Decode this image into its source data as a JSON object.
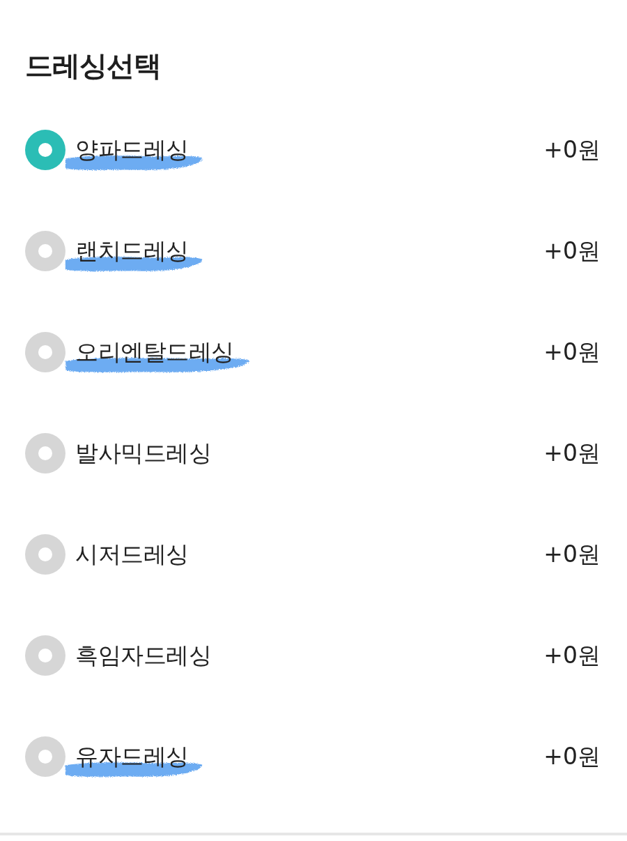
{
  "section": {
    "title": "드레싱선택"
  },
  "options": [
    {
      "label": "양파드레싱",
      "price": "+0원",
      "selected": true,
      "highlighted": true
    },
    {
      "label": "랜치드레싱",
      "price": "+0원",
      "selected": false,
      "highlighted": true
    },
    {
      "label": "오리엔탈드레싱",
      "price": "+0원",
      "selected": false,
      "highlighted": true
    },
    {
      "label": "발사믹드레싱",
      "price": "+0원",
      "selected": false,
      "highlighted": false
    },
    {
      "label": "시저드레싱",
      "price": "+0원",
      "selected": false,
      "highlighted": false
    },
    {
      "label": "흑임자드레싱",
      "price": "+0원",
      "selected": false,
      "highlighted": false
    },
    {
      "label": "유자드레싱",
      "price": "+0원",
      "selected": false,
      "highlighted": true
    }
  ]
}
